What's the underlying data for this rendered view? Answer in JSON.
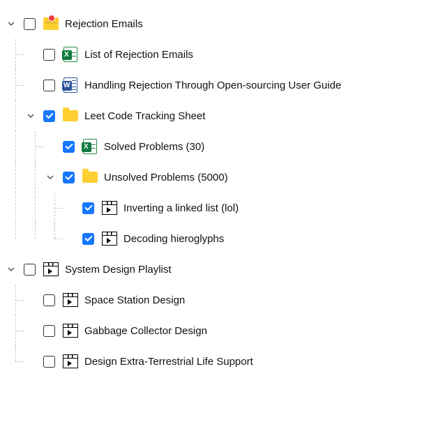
{
  "tree": [
    {
      "id": "rejection-emails",
      "label": "Rejection Emails",
      "checked": false,
      "expanded": true,
      "icon": "envelope",
      "depth": 0,
      "guides": [],
      "children": [
        {
          "id": "list-rejection-emails",
          "label": "List of Rejection Emails",
          "checked": false,
          "icon": "excel",
          "depth": 1,
          "guides": [
            "line-tee"
          ]
        },
        {
          "id": "handling-rejection-guide",
          "label": "Handling Rejection Through Open-sourcing User Guide",
          "checked": false,
          "icon": "word",
          "depth": 1,
          "guides": [
            "line-tee"
          ]
        },
        {
          "id": "leet-code-tracking",
          "label": "Leet Code Tracking Sheet",
          "checked": true,
          "expanded": true,
          "icon": "folder",
          "depth": 1,
          "guides": [
            "line"
          ],
          "children": [
            {
              "id": "solved-problems",
              "label": "Solved Problems (30)",
              "checked": true,
              "icon": "excel",
              "depth": 2,
              "guides": [
                "line",
                "line-tee"
              ]
            },
            {
              "id": "unsolved-problems",
              "label": "Unsolved Problems (5000)",
              "checked": true,
              "expanded": true,
              "icon": "folder",
              "depth": 2,
              "guides": [
                "line",
                "line"
              ],
              "children": [
                {
                  "id": "inverting-linked-list",
                  "label": "Inverting a linked list (lol)",
                  "checked": true,
                  "icon": "video",
                  "depth": 3,
                  "guides": [
                    "line",
                    "line",
                    "line-tee"
                  ]
                },
                {
                  "id": "decoding-hieroglyphs",
                  "label": "Decoding hieroglyphs",
                  "checked": true,
                  "icon": "video",
                  "depth": 3,
                  "guides": [
                    "lineend",
                    "lineend",
                    "lineend-tee"
                  ]
                }
              ]
            }
          ]
        }
      ]
    },
    {
      "id": "system-design-playlist",
      "label": "System Design Playlist",
      "checked": false,
      "expanded": true,
      "icon": "video",
      "depth": 0,
      "guides": [],
      "children": [
        {
          "id": "space-station-design",
          "label": "Space Station Design",
          "checked": false,
          "icon": "video",
          "depth": 1,
          "guides": [
            "line-tee"
          ]
        },
        {
          "id": "garbage-collector-design",
          "label": "Gabbage Collector Design",
          "checked": false,
          "icon": "video",
          "depth": 1,
          "guides": [
            "line-tee"
          ]
        },
        {
          "id": "design-et-life-support",
          "label": "Design Extra-Terrestrial Life Support",
          "checked": false,
          "icon": "video",
          "depth": 1,
          "guides": [
            "lineend-tee"
          ]
        }
      ]
    }
  ]
}
